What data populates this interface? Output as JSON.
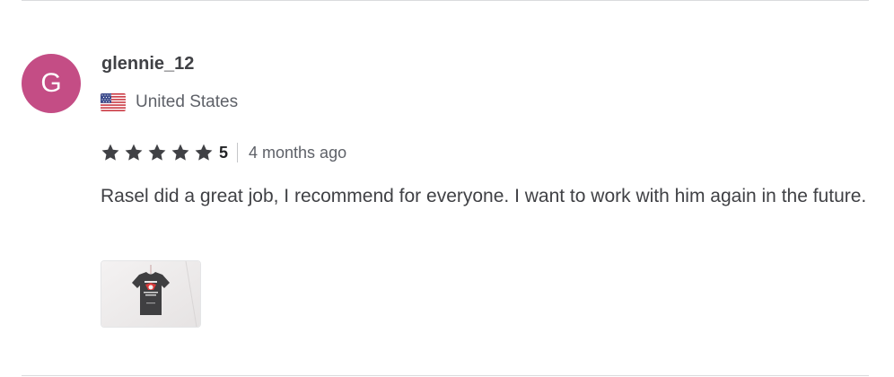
{
  "review": {
    "avatar_letter": "G",
    "username": "glennie_12",
    "country": "United States",
    "flag_icon": "us-flag-icon",
    "rating_value": "5",
    "stars": 5,
    "time_ago": "4 months ago",
    "text": "Rasel did a great job, I recommend for everyone. I want to work with him again in the future.",
    "attachment_icon": "t-shirt-thumbnail"
  },
  "colors": {
    "avatar_bg": "#c44d85",
    "star": "#404145",
    "text": "#404145",
    "muted": "#5e6168",
    "divider": "#dadbdd"
  }
}
